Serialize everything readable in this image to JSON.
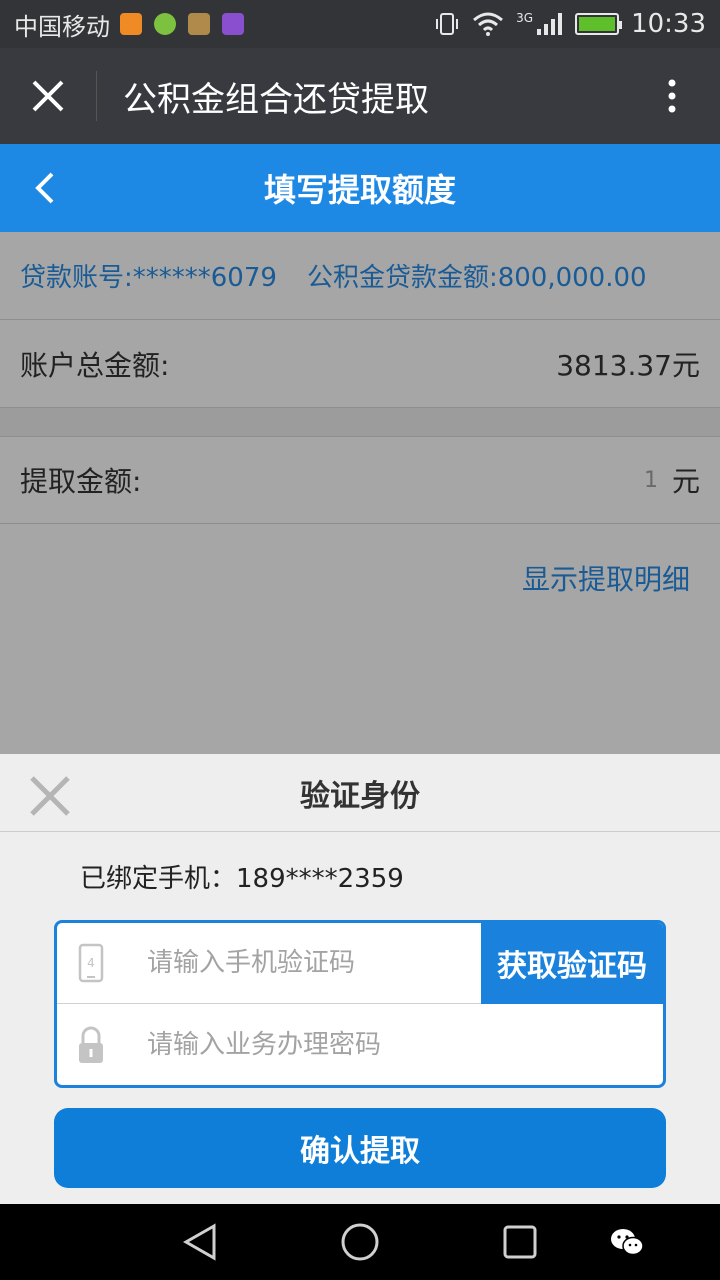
{
  "status_bar": {
    "carrier": "中国移动",
    "network": "3G",
    "time": "10:33"
  },
  "window": {
    "title": "公积金组合还贷提取"
  },
  "header": {
    "title": "填写提取额度"
  },
  "loan": {
    "account": "贷款账号:******6079",
    "amount": "公积金贷款金额:800,000.00"
  },
  "total": {
    "label": "账户总金额:",
    "value": "3813.37元"
  },
  "withdraw": {
    "label": "提取金额:",
    "value": "1",
    "unit": "元"
  },
  "detail_link": "显示提取明细",
  "verify": {
    "title": "验证身份",
    "bound_phone": "已绑定手机：189****2359",
    "code_placeholder": "请输入手机验证码",
    "get_code_label": "获取验证码",
    "password_placeholder": "请输入业务办理密码",
    "confirm_label": "确认提取"
  },
  "colors": {
    "header_blue": "#1e88e5",
    "link_blue": "#1a5b95",
    "button_blue": "#0f7ed8"
  }
}
